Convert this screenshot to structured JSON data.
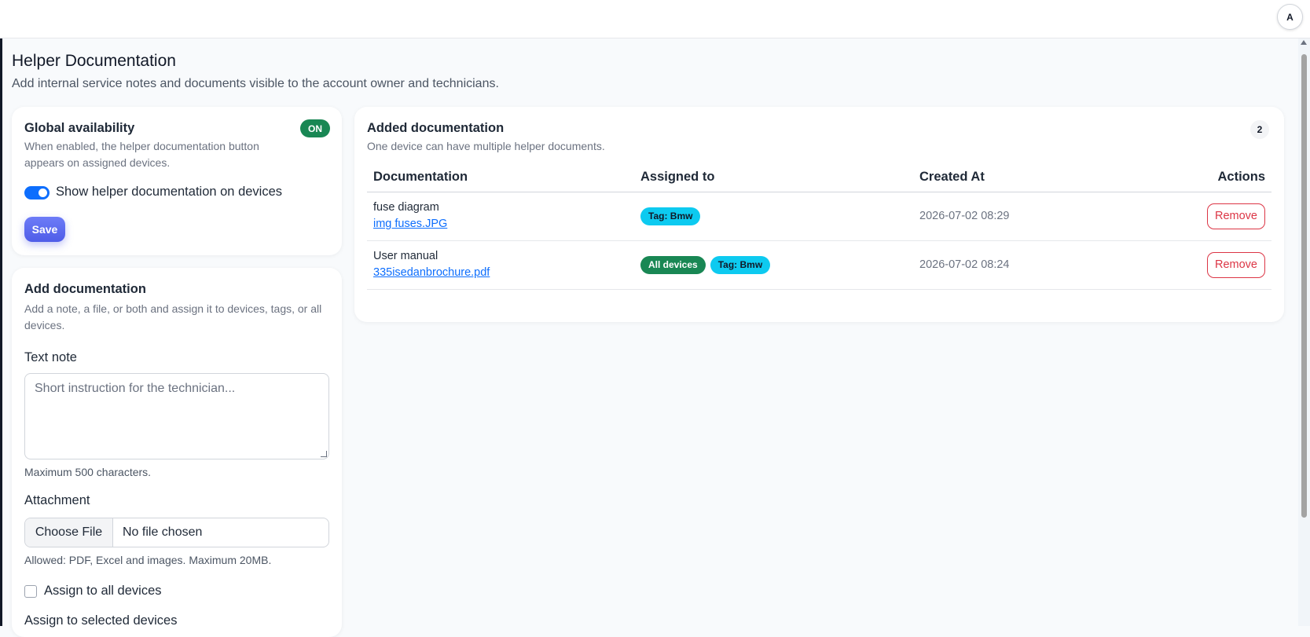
{
  "header": {
    "avatar_initial": "A"
  },
  "page": {
    "title": "Helper Documentation",
    "subtitle": "Add internal service notes and documents visible to the account owner and technicians."
  },
  "global_availability": {
    "title": "Global availability",
    "status_badge": "ON",
    "description": "When enabled, the helper documentation button appears on assigned devices.",
    "toggle_label": "Show helper documentation on devices",
    "toggle_on": true,
    "save_label": "Save"
  },
  "add_documentation": {
    "title": "Add documentation",
    "description": "Add a note, a file, or both and assign it to devices, tags, or all devices.",
    "text_note_label": "Text note",
    "text_note_placeholder": "Short instruction for the technician...",
    "text_note_hint": "Maximum 500 characters.",
    "attachment_label": "Attachment",
    "choose_file_label": "Choose File",
    "file_status": "No file chosen",
    "attachment_hint": "Allowed: PDF, Excel and images. Maximum 20MB.",
    "assign_all_label": "Assign to all devices",
    "assign_selected_label": "Assign to selected devices"
  },
  "added_documentation": {
    "title": "Added documentation",
    "description": "One device can have multiple helper documents.",
    "count": "2",
    "columns": {
      "documentation": "Documentation",
      "assigned_to": "Assigned to",
      "created_at": "Created At",
      "actions": "Actions"
    },
    "rows": [
      {
        "name": "fuse diagram",
        "file": "img fuses.JPG",
        "tags": [
          "Tag: Bmw"
        ],
        "created": "2026-07-02 08:29",
        "action": "Remove"
      },
      {
        "name": "User manual",
        "file": "335isedanbrochure.pdf",
        "tags": [
          "All devices",
          "Tag: Bmw"
        ],
        "created": "2026-07-02 08:24",
        "action": "Remove"
      }
    ]
  },
  "colors": {
    "accent": "#0d6efd",
    "success": "#198754",
    "info": "#0dcaf0",
    "danger": "#dc3545",
    "save_button": "#5a68ef"
  }
}
